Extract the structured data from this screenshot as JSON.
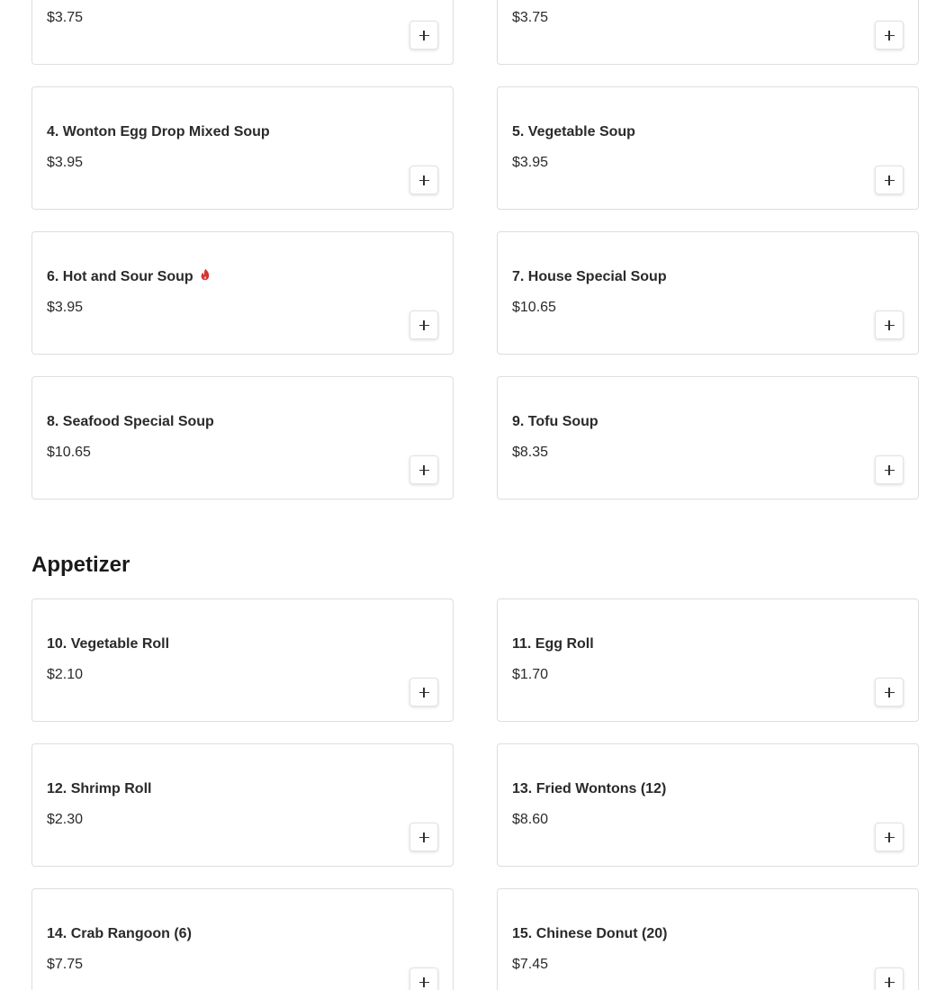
{
  "sections": [
    {
      "title": "",
      "items": [
        {
          "name": "",
          "price": "$3.75",
          "spicy": false
        },
        {
          "name": "",
          "price": "$3.75",
          "spicy": false
        },
        {
          "name": "4. Wonton Egg Drop Mixed Soup",
          "price": "$3.95",
          "spicy": false
        },
        {
          "name": "5. Vegetable Soup",
          "price": "$3.95",
          "spicy": false
        },
        {
          "name": "6. Hot and Sour Soup",
          "price": "$3.95",
          "spicy": true
        },
        {
          "name": "7. House Special Soup",
          "price": "$10.65",
          "spicy": false
        },
        {
          "name": "8. Seafood Special Soup",
          "price": "$10.65",
          "spicy": false
        },
        {
          "name": "9. Tofu Soup",
          "price": "$8.35",
          "spicy": false
        }
      ]
    },
    {
      "title": "Appetizer",
      "items": [
        {
          "name": "10. Vegetable Roll",
          "price": "$2.10",
          "spicy": false
        },
        {
          "name": "11. Egg Roll",
          "price": "$1.70",
          "spicy": false
        },
        {
          "name": "12. Shrimp Roll",
          "price": "$2.30",
          "spicy": false
        },
        {
          "name": "13. Fried Wontons (12)",
          "price": "$8.60",
          "spicy": false
        },
        {
          "name": "14. Crab Rangoon (6)",
          "price": "$7.75",
          "spicy": false
        },
        {
          "name": "15. Chinese Donut (20)",
          "price": "$7.45",
          "spicy": false
        }
      ]
    }
  ],
  "icons": {
    "add": "plus-icon",
    "spicy": "chili-pepper-icon"
  },
  "colors": {
    "spicy": "#d6332f",
    "card_border": "#dedede",
    "text": "#2a2a2a"
  }
}
